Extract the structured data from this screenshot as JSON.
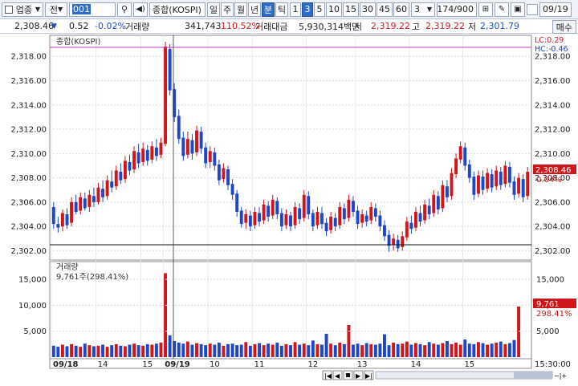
{
  "toolbar": {
    "market_label": "업종",
    "type_label": "전",
    "code_value": "001",
    "name_value": "종합(KOSPI)",
    "periods": [
      "일",
      "주",
      "월",
      "년",
      "분",
      "틱"
    ],
    "selected_period": "분",
    "intervals": [
      "1",
      "3",
      "5",
      "10",
      "15",
      "30",
      "45",
      "60"
    ],
    "selected_interval": "3",
    "custom_interval": "3",
    "count_value": "174/900",
    "date_value": "09/19"
  },
  "info": {
    "price": "2,308.46",
    "change": "0.52",
    "change_pct": "-0.02%",
    "volume_label": "거래량",
    "volume": "341,743",
    "volume_ratio": "110.52%",
    "amount_label": "거래대금",
    "amount": "5,930,314백만",
    "open_label": "시",
    "open": "2,319.22",
    "high_label": "고",
    "high": "2,319.22",
    "low_label": "저",
    "low": "2,301.79",
    "sell_button": "매수"
  },
  "price_panel": {
    "title": "종합(KOSPI)",
    "lc_label": "LC:0.29",
    "hc_label": "HC:-0.46",
    "last_price_tag": "2,308.46",
    "last_pct_tag": "0.04%",
    "y_ticks": [
      "2,318.00",
      "2,316.00",
      "2,314.00",
      "2,312.00",
      "2,310.00",
      "2,308.00",
      "2,306.00",
      "2,304.00",
      "2,302.00"
    ]
  },
  "volume_panel": {
    "title": "거래량",
    "last_label": "9,761주(298.41%)",
    "last_tag": "9,761",
    "last_pct_tag": "298.41%",
    "y_ticks": [
      "15,000",
      "10,000",
      "5,000"
    ]
  },
  "x_axis": {
    "labels": [
      "09/18",
      "14",
      "15",
      "09/19",
      "10",
      "11",
      "12",
      "13",
      "14",
      "15"
    ],
    "time_label": "15:30:00"
  },
  "colors": {
    "up": "#d0161b",
    "down": "#1d46c8",
    "accent": "#2f6bc8",
    "hc_line": "#cc33cc"
  },
  "chart_data": {
    "type": "candlestick",
    "title": "종합(KOSPI)",
    "ylim": [
      2301.5,
      2319.6
    ],
    "candles": [
      {
        "o": 2305.6,
        "c": 2304.2,
        "h": 2306.0,
        "l": 2303.8
      },
      {
        "o": 2304.2,
        "c": 2303.9,
        "h": 2304.8,
        "l": 2303.5
      },
      {
        "o": 2304.0,
        "c": 2305.1,
        "h": 2305.4,
        "l": 2303.6
      },
      {
        "o": 2305.0,
        "c": 2304.1,
        "h": 2305.5,
        "l": 2303.8
      },
      {
        "o": 2304.3,
        "c": 2306.0,
        "h": 2306.4,
        "l": 2304.0
      },
      {
        "o": 2306.0,
        "c": 2305.2,
        "h": 2306.6,
        "l": 2305.0
      },
      {
        "o": 2305.3,
        "c": 2306.4,
        "h": 2306.8,
        "l": 2305.0
      },
      {
        "o": 2306.3,
        "c": 2305.5,
        "h": 2306.8,
        "l": 2305.3
      },
      {
        "o": 2305.6,
        "c": 2306.6,
        "h": 2307.0,
        "l": 2305.2
      },
      {
        "o": 2306.5,
        "c": 2306.0,
        "h": 2307.2,
        "l": 2305.6
      },
      {
        "o": 2306.0,
        "c": 2307.2,
        "h": 2307.6,
        "l": 2305.8
      },
      {
        "o": 2307.1,
        "c": 2306.4,
        "h": 2307.8,
        "l": 2306.0
      },
      {
        "o": 2306.5,
        "c": 2307.8,
        "h": 2308.2,
        "l": 2306.2
      },
      {
        "o": 2307.7,
        "c": 2307.2,
        "h": 2308.6,
        "l": 2306.8
      },
      {
        "o": 2307.3,
        "c": 2308.6,
        "h": 2309.0,
        "l": 2307.0
      },
      {
        "o": 2308.5,
        "c": 2307.8,
        "h": 2309.2,
        "l": 2307.5
      },
      {
        "o": 2307.9,
        "c": 2309.4,
        "h": 2309.8,
        "l": 2307.6
      },
      {
        "o": 2309.3,
        "c": 2308.6,
        "h": 2309.9,
        "l": 2308.2
      },
      {
        "o": 2308.7,
        "c": 2310.2,
        "h": 2310.6,
        "l": 2308.4
      },
      {
        "o": 2310.1,
        "c": 2309.2,
        "h": 2310.8,
        "l": 2308.8
      },
      {
        "o": 2309.3,
        "c": 2310.4,
        "h": 2310.9,
        "l": 2309.0
      },
      {
        "o": 2310.3,
        "c": 2309.4,
        "h": 2310.7,
        "l": 2309.0
      },
      {
        "o": 2309.5,
        "c": 2310.6,
        "h": 2311.0,
        "l": 2309.2
      },
      {
        "o": 2310.5,
        "c": 2309.8,
        "h": 2311.2,
        "l": 2309.4
      },
      {
        "o": 2309.9,
        "c": 2310.9,
        "h": 2311.3,
        "l": 2309.6
      },
      {
        "o": 2310.8,
        "c": 2318.8,
        "h": 2319.2,
        "l": 2310.6
      },
      {
        "o": 2318.6,
        "c": 2315.2,
        "h": 2319.0,
        "l": 2314.8
      },
      {
        "o": 2315.3,
        "c": 2313.0,
        "h": 2315.8,
        "l": 2312.6
      },
      {
        "o": 2313.1,
        "c": 2311.2,
        "h": 2313.6,
        "l": 2310.8
      },
      {
        "o": 2311.3,
        "c": 2309.8,
        "h": 2311.8,
        "l": 2309.4
      },
      {
        "o": 2309.9,
        "c": 2311.2,
        "h": 2311.8,
        "l": 2309.6
      },
      {
        "o": 2311.1,
        "c": 2310.0,
        "h": 2311.6,
        "l": 2309.5
      },
      {
        "o": 2310.1,
        "c": 2311.9,
        "h": 2312.3,
        "l": 2309.8
      },
      {
        "o": 2311.8,
        "c": 2310.4,
        "h": 2312.2,
        "l": 2310.0
      },
      {
        "o": 2310.5,
        "c": 2309.2,
        "h": 2310.9,
        "l": 2308.8
      },
      {
        "o": 2309.3,
        "c": 2310.2,
        "h": 2310.6,
        "l": 2308.8
      },
      {
        "o": 2310.1,
        "c": 2309.0,
        "h": 2310.5,
        "l": 2308.6
      },
      {
        "o": 2309.1,
        "c": 2307.8,
        "h": 2309.5,
        "l": 2307.4
      },
      {
        "o": 2307.9,
        "c": 2308.8,
        "h": 2309.2,
        "l": 2307.6
      },
      {
        "o": 2308.7,
        "c": 2307.4,
        "h": 2309.0,
        "l": 2307.0
      },
      {
        "o": 2307.5,
        "c": 2306.6,
        "h": 2307.9,
        "l": 2306.2
      },
      {
        "o": 2306.7,
        "c": 2305.2,
        "h": 2307.0,
        "l": 2304.8
      },
      {
        "o": 2305.3,
        "c": 2304.2,
        "h": 2305.6,
        "l": 2303.9
      },
      {
        "o": 2304.3,
        "c": 2305.0,
        "h": 2305.4,
        "l": 2303.8
      },
      {
        "o": 2304.9,
        "c": 2304.0,
        "h": 2305.3,
        "l": 2303.6
      },
      {
        "o": 2304.1,
        "c": 2305.2,
        "h": 2305.6,
        "l": 2303.8
      },
      {
        "o": 2305.1,
        "c": 2304.4,
        "h": 2305.6,
        "l": 2304.0
      },
      {
        "o": 2304.5,
        "c": 2305.8,
        "h": 2306.2,
        "l": 2304.2
      },
      {
        "o": 2305.7,
        "c": 2304.8,
        "h": 2306.1,
        "l": 2304.4
      },
      {
        "o": 2304.9,
        "c": 2306.2,
        "h": 2306.6,
        "l": 2304.6
      },
      {
        "o": 2306.1,
        "c": 2305.0,
        "h": 2306.4,
        "l": 2304.6
      },
      {
        "o": 2305.1,
        "c": 2304.0,
        "h": 2305.5,
        "l": 2303.6
      },
      {
        "o": 2304.1,
        "c": 2305.0,
        "h": 2305.4,
        "l": 2303.8
      },
      {
        "o": 2304.9,
        "c": 2304.0,
        "h": 2305.2,
        "l": 2303.6
      },
      {
        "o": 2304.1,
        "c": 2305.6,
        "h": 2306.0,
        "l": 2303.8
      },
      {
        "o": 2305.5,
        "c": 2304.6,
        "h": 2305.9,
        "l": 2304.2
      },
      {
        "o": 2304.7,
        "c": 2306.6,
        "h": 2307.0,
        "l": 2304.4
      },
      {
        "o": 2306.5,
        "c": 2305.0,
        "h": 2306.9,
        "l": 2304.6
      },
      {
        "o": 2305.1,
        "c": 2304.0,
        "h": 2305.4,
        "l": 2303.6
      },
      {
        "o": 2304.1,
        "c": 2305.2,
        "h": 2305.6,
        "l": 2303.8
      },
      {
        "o": 2305.1,
        "c": 2304.2,
        "h": 2305.6,
        "l": 2303.8
      },
      {
        "o": 2304.3,
        "c": 2303.6,
        "h": 2304.7,
        "l": 2303.2
      },
      {
        "o": 2303.7,
        "c": 2304.8,
        "h": 2305.2,
        "l": 2303.4
      },
      {
        "o": 2304.7,
        "c": 2304.0,
        "h": 2305.1,
        "l": 2303.6
      },
      {
        "o": 2304.1,
        "c": 2305.6,
        "h": 2306.0,
        "l": 2303.8
      },
      {
        "o": 2305.5,
        "c": 2304.6,
        "h": 2305.9,
        "l": 2304.2
      },
      {
        "o": 2304.7,
        "c": 2306.2,
        "h": 2306.6,
        "l": 2304.4
      },
      {
        "o": 2306.1,
        "c": 2305.2,
        "h": 2306.5,
        "l": 2304.8
      },
      {
        "o": 2305.3,
        "c": 2304.2,
        "h": 2305.7,
        "l": 2303.8
      },
      {
        "o": 2304.3,
        "c": 2305.0,
        "h": 2305.4,
        "l": 2303.9
      },
      {
        "o": 2304.9,
        "c": 2304.4,
        "h": 2305.3,
        "l": 2304.0
      },
      {
        "o": 2304.5,
        "c": 2305.6,
        "h": 2306.0,
        "l": 2304.2
      },
      {
        "o": 2305.5,
        "c": 2304.8,
        "h": 2305.9,
        "l": 2304.4
      },
      {
        "o": 2304.9,
        "c": 2304.0,
        "h": 2305.3,
        "l": 2303.6
      },
      {
        "o": 2304.1,
        "c": 2303.2,
        "h": 2304.5,
        "l": 2302.8
      },
      {
        "o": 2303.3,
        "c": 2302.4,
        "h": 2303.7,
        "l": 2301.9
      },
      {
        "o": 2302.5,
        "c": 2303.0,
        "h": 2303.4,
        "l": 2302.0
      },
      {
        "o": 2302.9,
        "c": 2302.2,
        "h": 2303.3,
        "l": 2301.9
      },
      {
        "o": 2302.3,
        "c": 2303.2,
        "h": 2303.6,
        "l": 2302.0
      },
      {
        "o": 2303.1,
        "c": 2304.4,
        "h": 2304.8,
        "l": 2302.8
      },
      {
        "o": 2304.3,
        "c": 2303.8,
        "h": 2304.9,
        "l": 2303.4
      },
      {
        "o": 2303.9,
        "c": 2305.2,
        "h": 2305.6,
        "l": 2303.6
      },
      {
        "o": 2305.1,
        "c": 2304.4,
        "h": 2305.7,
        "l": 2304.0
      },
      {
        "o": 2304.5,
        "c": 2305.8,
        "h": 2306.2,
        "l": 2304.2
      },
      {
        "o": 2305.7,
        "c": 2305.0,
        "h": 2306.3,
        "l": 2304.6
      },
      {
        "o": 2305.1,
        "c": 2306.6,
        "h": 2307.0,
        "l": 2304.8
      },
      {
        "o": 2306.5,
        "c": 2305.4,
        "h": 2306.9,
        "l": 2305.0
      },
      {
        "o": 2305.5,
        "c": 2307.4,
        "h": 2307.8,
        "l": 2305.2
      },
      {
        "o": 2307.3,
        "c": 2306.4,
        "h": 2307.8,
        "l": 2306.0
      },
      {
        "o": 2306.5,
        "c": 2308.4,
        "h": 2308.8,
        "l": 2306.2
      },
      {
        "o": 2308.3,
        "c": 2309.6,
        "h": 2310.0,
        "l": 2308.0
      },
      {
        "o": 2309.5,
        "c": 2310.6,
        "h": 2311.0,
        "l": 2309.2
      },
      {
        "o": 2310.5,
        "c": 2309.0,
        "h": 2310.9,
        "l": 2308.6
      },
      {
        "o": 2309.1,
        "c": 2308.0,
        "h": 2309.5,
        "l": 2307.6
      },
      {
        "o": 2308.1,
        "c": 2306.6,
        "h": 2308.5,
        "l": 2306.2
      },
      {
        "o": 2306.7,
        "c": 2308.2,
        "h": 2308.6,
        "l": 2306.4
      },
      {
        "o": 2308.1,
        "c": 2307.0,
        "h": 2308.6,
        "l": 2306.6
      },
      {
        "o": 2307.1,
        "c": 2308.4,
        "h": 2308.8,
        "l": 2306.8
      },
      {
        "o": 2308.3,
        "c": 2307.2,
        "h": 2308.7,
        "l": 2306.8
      },
      {
        "o": 2307.3,
        "c": 2308.6,
        "h": 2309.0,
        "l": 2307.0
      },
      {
        "o": 2308.5,
        "c": 2307.4,
        "h": 2308.9,
        "l": 2307.0
      },
      {
        "o": 2307.5,
        "c": 2309.0,
        "h": 2309.4,
        "l": 2307.2
      },
      {
        "o": 2308.9,
        "c": 2307.6,
        "h": 2309.3,
        "l": 2307.2
      },
      {
        "o": 2307.7,
        "c": 2306.6,
        "h": 2308.1,
        "l": 2306.2
      },
      {
        "o": 2306.7,
        "c": 2308.0,
        "h": 2308.4,
        "l": 2306.4
      },
      {
        "o": 2307.9,
        "c": 2306.4,
        "h": 2308.3,
        "l": 2306.0
      },
      {
        "o": 2306.5,
        "c": 2308.5,
        "h": 2308.9,
        "l": 2306.2
      }
    ],
    "volume": [
      2.2,
      2.0,
      2.4,
      2.1,
      2.5,
      2.2,
      2.0,
      2.6,
      2.3,
      2.1,
      2.2,
      2.4,
      2.0,
      2.3,
      2.5,
      2.2,
      2.1,
      2.4,
      2.6,
      2.3,
      2.2,
      2.5,
      2.4,
      2.6,
      2.8,
      16.2,
      4.2,
      3.1,
      2.8,
      2.6,
      3.0,
      2.4,
      2.7,
      2.5,
      2.3,
      2.6,
      2.4,
      2.8,
      2.2,
      2.5,
      2.6,
      2.3,
      2.4,
      2.9,
      2.2,
      2.5,
      2.7,
      2.3,
      2.6,
      2.4,
      2.8,
      2.2,
      2.5,
      2.3,
      2.9,
      2.4,
      2.6,
      2.3,
      3.2,
      2.5,
      2.4,
      4.5,
      2.6,
      2.3,
      2.8,
      2.5,
      6.2,
      2.4,
      2.6,
      2.3,
      2.7,
      2.5,
      2.4,
      2.6,
      4.4,
      2.3,
      2.8,
      2.5,
      2.6,
      3.0,
      2.4,
      2.7,
      2.5,
      2.3,
      2.9,
      2.6,
      2.4,
      2.7,
      3.1,
      2.5,
      2.8,
      2.4,
      3.4,
      2.6,
      2.5,
      2.9,
      2.7,
      2.4,
      2.6,
      2.8,
      3.0,
      2.5,
      2.7,
      3.3,
      9.76
    ],
    "volume_ylim": [
      0,
      17.5
    ]
  }
}
